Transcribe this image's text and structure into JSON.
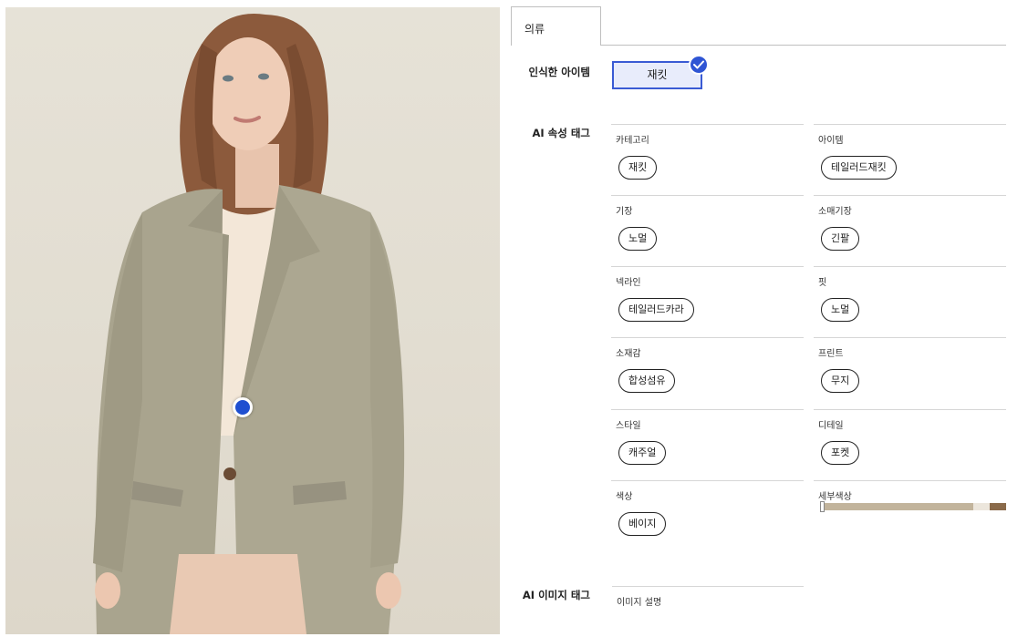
{
  "tab": {
    "label": "의류"
  },
  "labels": {
    "recognized": "인식한 아이템",
    "ai_attr": "AI 속성 태그",
    "ai_image": "AI 이미지 태그"
  },
  "recognized_item": {
    "label": "재킷",
    "selected": true
  },
  "attributes": [
    {
      "label": "카테고리",
      "value": "재킷"
    },
    {
      "label": "아이템",
      "value": "테일러드재킷"
    },
    {
      "label": "기장",
      "value": "노멀"
    },
    {
      "label": "소매기장",
      "value": "긴팔"
    },
    {
      "label": "넥라인",
      "value": "테일러드카라"
    },
    {
      "label": "핏",
      "value": "노멀"
    },
    {
      "label": "소재감",
      "value": "합성섬유"
    },
    {
      "label": "프린트",
      "value": "무지"
    },
    {
      "label": "스타일",
      "value": "캐주얼"
    },
    {
      "label": "디테일",
      "value": "포켓"
    },
    {
      "label": "색상",
      "value": "베이지"
    },
    {
      "label": "세부색상",
      "value": ""
    }
  ],
  "detail_colors": [
    {
      "color": "#c2b49c",
      "share": 0.825
    },
    {
      "color": "#ece6dc",
      "share": 0.085
    },
    {
      "color": "#8a6a4a",
      "share": 0.09
    }
  ],
  "image_tag": {
    "label": "이미지 설명"
  },
  "colors": {
    "accent": "#2f55d4",
    "selected_bg": "#e8ecfb"
  }
}
